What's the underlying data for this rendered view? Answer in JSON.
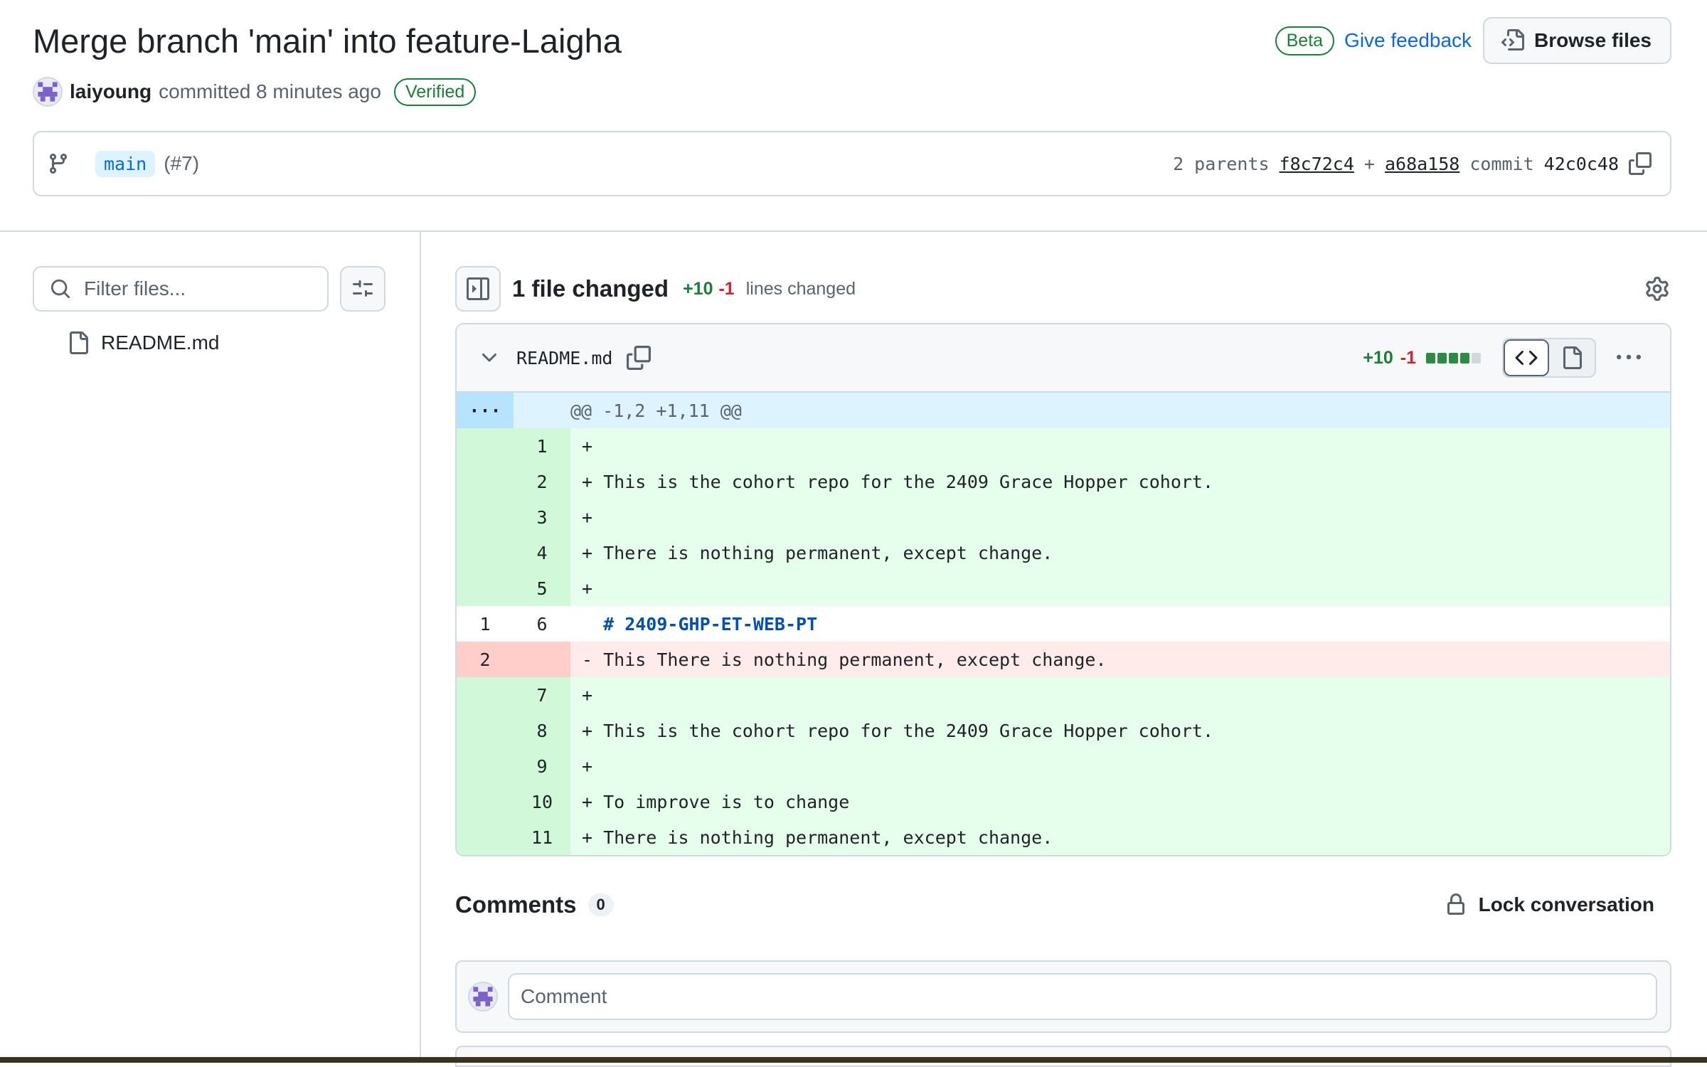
{
  "commit": {
    "title": "Merge branch 'main' into feature-Laigha",
    "author": "laiyoung",
    "action_text": "committed 8 minutes ago",
    "verified_label": "Verified",
    "branch": "main",
    "pr_ref": "(#7)",
    "parents_label": "2 parents",
    "parent1": "f8c72c4",
    "plus": "+",
    "parent2": "a68a158",
    "commit_label": "commit",
    "sha": "42c0c48"
  },
  "header_actions": {
    "beta_label": "Beta",
    "feedback_label": "Give feedback",
    "browse_label": "Browse files"
  },
  "sidebar": {
    "filter_placeholder": "Filter files...",
    "files": [
      {
        "name": "README.md",
        "icon": "file-icon"
      }
    ]
  },
  "summary": {
    "files_changed": "1 file changed",
    "additions": "+10",
    "deletions": "-1",
    "lines_changed": "lines changed"
  },
  "diff_file": {
    "name": "README.md",
    "additions": "+10",
    "deletions": "-1",
    "stat_blocks": [
      "add",
      "add",
      "add",
      "add",
      "neutral"
    ],
    "hunk_expander": "···",
    "hunk_header": "@@ -1,2 +1,11 @@",
    "lines": [
      {
        "type": "add",
        "old": "",
        "new": "1",
        "text": "+"
      },
      {
        "type": "add",
        "old": "",
        "new": "2",
        "text": "+ This is the cohort repo for the 2409 Grace Hopper cohort."
      },
      {
        "type": "add",
        "old": "",
        "new": "3",
        "text": "+"
      },
      {
        "type": "add",
        "old": "",
        "new": "4",
        "text": "+ There is nothing permanent, except change."
      },
      {
        "type": "add",
        "old": "",
        "new": "5",
        "text": "+"
      },
      {
        "type": "ctx",
        "old": "1",
        "new": "6",
        "text": "  # 2409-GHP-ET-WEB-PT"
      },
      {
        "type": "del",
        "old": "2",
        "new": "",
        "text": "- This There is nothing permanent, except change."
      },
      {
        "type": "add",
        "old": "",
        "new": "7",
        "text": "+"
      },
      {
        "type": "add",
        "old": "",
        "new": "8",
        "text": "+ This is the cohort repo for the 2409 Grace Hopper cohort."
      },
      {
        "type": "add",
        "old": "",
        "new": "9",
        "text": "+"
      },
      {
        "type": "add",
        "old": "",
        "new": "10",
        "text": "+ To improve is to change"
      },
      {
        "type": "add",
        "old": "",
        "new": "11",
        "text": "+ There is nothing permanent, except change."
      }
    ]
  },
  "comments": {
    "title": "Comments",
    "count": "0",
    "lock_label": "Lock conversation",
    "placeholder": "Comment"
  },
  "colors": {
    "accent": "#0969da",
    "success": "#1a7f37",
    "danger": "#d1242f",
    "add_bg": "#e6ffec",
    "del_bg": "#ffebe9",
    "hunk_bg": "#ddf4ff"
  }
}
